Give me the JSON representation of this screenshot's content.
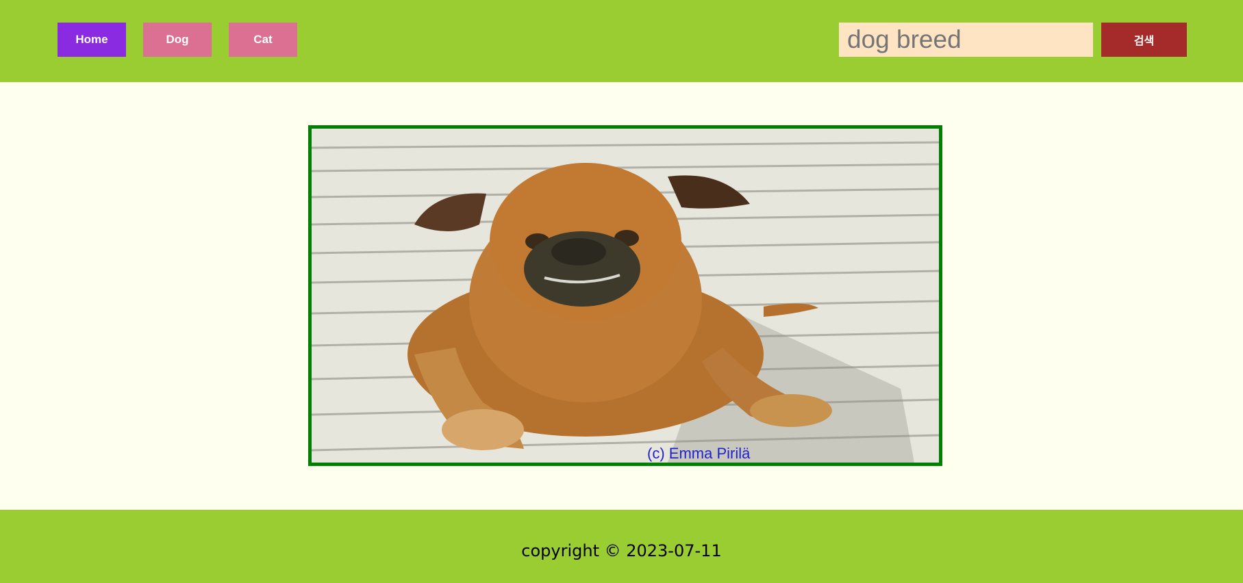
{
  "nav": {
    "home_label": "Home",
    "dog_label": "Dog",
    "cat_label": "Cat"
  },
  "search": {
    "placeholder": "dog breed",
    "button_label": "검색"
  },
  "main": {
    "image_alt": "dog photo",
    "image_caption": "(c) Emma Pirilä"
  },
  "footer": {
    "copyright": "copyright © 2023-07-11"
  },
  "colors": {
    "header_bg": "#9acd32",
    "page_bg": "#fffff0",
    "home_button": "#8a2be2",
    "nav_button": "#db7093",
    "search_input_bg": "#ffe4c4",
    "search_button": "#a52a2a",
    "image_border": "#008000"
  }
}
